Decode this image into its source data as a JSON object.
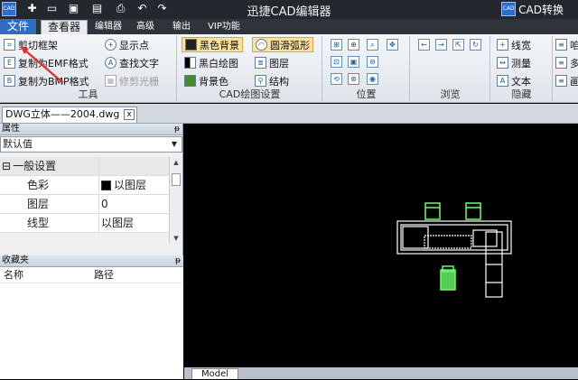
{
  "titlebar": {
    "app_logo": "CAD",
    "title": "迅捷CAD编辑器",
    "convert_logo": "CAD",
    "convert_label": "CAD转换",
    "quick_access": [
      "new-icon",
      "open-icon",
      "save-icon",
      "print-icon",
      "undo-icon",
      "redo-icon"
    ]
  },
  "tabs": {
    "file": "文件",
    "viewer": "查看器",
    "editor": "编辑器",
    "advanced": "高级",
    "output": "输出",
    "vip": "VIP功能"
  },
  "ribbon": {
    "tools": {
      "label": "工具",
      "clip_frame": "剪切框架",
      "copy_emf": "复制为EMF格式",
      "copy_bmp": "复制为BMP格式",
      "show_points": "显示点",
      "find_text": "查找文字",
      "trim_raster": "修剪光栅"
    },
    "cad_settings": {
      "label": "CAD绘图设置",
      "black_bg": "黑色背景",
      "bw_drawing": "黑白绘图",
      "bg_color": "背景色",
      "smooth_arc": "圆滑弧形",
      "layers": "图层",
      "structure": "结构"
    },
    "position": {
      "label": "位置"
    },
    "browse": {
      "label": "浏览"
    },
    "hide": {
      "label": "隐藏",
      "line_width": "线宽",
      "measure": "测量",
      "text": "文本"
    },
    "more": {
      "item1": "咱",
      "item2": "多",
      "item3": "画"
    }
  },
  "document": {
    "tab_title": "DWG立体——2004.dwg",
    "close": "x"
  },
  "properties": {
    "header": "属性",
    "pin": "ᵽ",
    "dropdown_value": "默认值",
    "group": "一般设置",
    "collapse": "⊟",
    "rows": [
      {
        "key": "色彩",
        "value": "以图层",
        "color": "#000000"
      },
      {
        "key": "图层",
        "value": "0"
      },
      {
        "key": "线型",
        "value": "以图层"
      }
    ]
  },
  "favorites": {
    "header": "收藏夹",
    "pin": "ᵽ",
    "col_name": "名称",
    "col_path": "路径"
  },
  "bottom": {
    "model_tab": "Model"
  },
  "colors": {
    "canvas_bg": "#000000",
    "drawing_green": "#66ff66",
    "drawing_white": "#ffffff",
    "accent_blue": "#2e6dc0",
    "annotation_red": "#e03030"
  }
}
